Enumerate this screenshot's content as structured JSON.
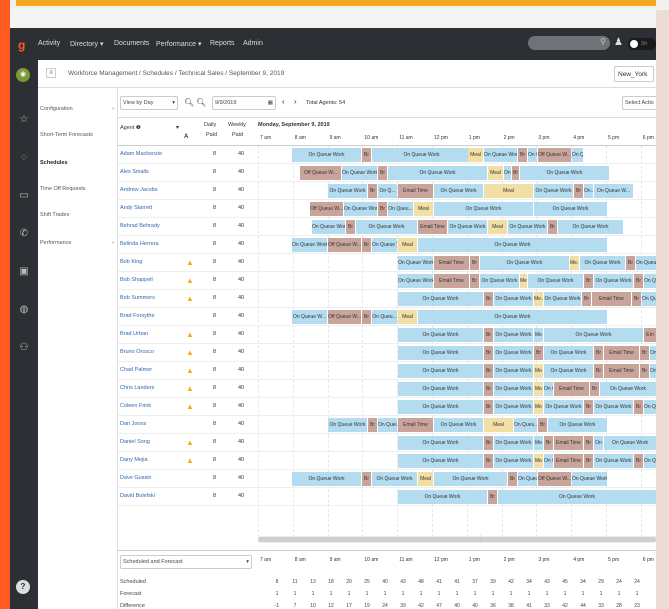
{
  "nav": {
    "items": [
      "Activity",
      "Directory ▾",
      "Documents",
      "Performance ▾",
      "Reports",
      "Admin"
    ]
  },
  "topbar": {
    "toggle_label": "Sh"
  },
  "breadcrumb": {
    "text": "Workforce Management / Schedules / Technical Sales / September 9, 2019"
  },
  "timezone": "New_York",
  "sidebar": {
    "items": [
      {
        "label": "Configuration",
        "chev": "›"
      },
      {
        "label": "Short-Term Forecasts",
        "chev": ""
      },
      {
        "label": "Schedules",
        "chev": ""
      },
      {
        "label": "Time Off Requests",
        "chev": ""
      },
      {
        "label": "Shift Trades",
        "chev": ""
      },
      {
        "label": "Performance",
        "chev": "›"
      }
    ]
  },
  "toolbar": {
    "view": "View by Day",
    "date": "9/9/2019",
    "total": "Total Agents: 54",
    "select_action": "Select Actio"
  },
  "header": {
    "agent": "Agent",
    "daily": "Daily",
    "paid1": "Paid",
    "weekly": "Weekly",
    "paid2": "Paid",
    "date": "Monday, September 9, 2019"
  },
  "hours": [
    "7 am",
    "8 am",
    "9 am",
    "10 am",
    "11 am",
    "12 pm",
    "1 pm",
    "2 pm",
    "3 pm",
    "4 pm",
    "5 pm",
    "6 pm"
  ],
  "agents": [
    {
      "name": "Adam Mackenzie",
      "warn": false,
      "daily": "8",
      "weekly": "40"
    },
    {
      "name": "Alex Smalls",
      "warn": false,
      "daily": "8",
      "weekly": "40"
    },
    {
      "name": "Andrew Jacobs",
      "warn": false,
      "daily": "8",
      "weekly": "40"
    },
    {
      "name": "Andy Starrett",
      "warn": false,
      "daily": "8",
      "weekly": "40"
    },
    {
      "name": "Behrad Behrady",
      "warn": false,
      "daily": "8",
      "weekly": "40"
    },
    {
      "name": "Belinda Herrera",
      "warn": false,
      "daily": "8",
      "weekly": "40"
    },
    {
      "name": "Bob King",
      "warn": true,
      "daily": "8",
      "weekly": "40"
    },
    {
      "name": "Bob Shappell",
      "warn": true,
      "daily": "8",
      "weekly": "40"
    },
    {
      "name": "Bob Summers",
      "warn": true,
      "daily": "8",
      "weekly": "40"
    },
    {
      "name": "Brad Forsythe",
      "warn": false,
      "daily": "8",
      "weekly": "40"
    },
    {
      "name": "Brad Urban",
      "warn": true,
      "daily": "8",
      "weekly": "40"
    },
    {
      "name": "Bruno Orozco",
      "warn": true,
      "daily": "8",
      "weekly": "40"
    },
    {
      "name": "Chad Palmer",
      "warn": true,
      "daily": "8",
      "weekly": "40"
    },
    {
      "name": "Chris Landers",
      "warn": true,
      "daily": "8",
      "weekly": "40"
    },
    {
      "name": "Coleen Frink",
      "warn": true,
      "daily": "8",
      "weekly": "40"
    },
    {
      "name": "Dan Joons",
      "warn": false,
      "daily": "8",
      "weekly": "40"
    },
    {
      "name": "Daniel Song",
      "warn": true,
      "daily": "8",
      "weekly": "40"
    },
    {
      "name": "Dany Mejia",
      "warn": true,
      "daily": "8",
      "weekly": "40"
    },
    {
      "name": "Dave Gussin",
      "warn": false,
      "daily": "8",
      "weekly": "40"
    },
    {
      "name": "David Bolefski",
      "warn": false,
      "daily": "8",
      "weekly": "40"
    }
  ],
  "rows_segments": [
    [
      [
        "q",
        34,
        70,
        "On Queue Work"
      ],
      [
        "o",
        104,
        10,
        "Br"
      ],
      [
        "q",
        114,
        100,
        "On Queue Work"
      ],
      [
        "m",
        210,
        16,
        "Meal"
      ],
      [
        "q",
        226,
        34,
        "On Queue Work"
      ],
      [
        "o",
        260,
        10,
        "Br"
      ],
      [
        "q",
        270,
        10,
        "On Q..."
      ],
      [
        "o",
        280,
        34,
        "Off Queue W..."
      ],
      [
        "q",
        314,
        12,
        "On Q..."
      ]
    ],
    [
      [
        "o",
        42,
        42,
        "Off Queue W..."
      ],
      [
        "q",
        84,
        36,
        "On Queue Work"
      ],
      [
        "o",
        120,
        10,
        "Br"
      ],
      [
        "q",
        130,
        100,
        "On Queue Work"
      ],
      [
        "m",
        230,
        16,
        "Meal"
      ],
      [
        "q",
        246,
        8,
        "On Q..."
      ],
      [
        "o",
        254,
        8,
        "Br"
      ],
      [
        "q",
        262,
        90,
        "On Queue Work"
      ]
    ],
    [
      [
        "q",
        70,
        40,
        "On Queue Work"
      ],
      [
        "o",
        110,
        10,
        "Br"
      ],
      [
        "q",
        120,
        20,
        "On Q..."
      ],
      [
        "t",
        140,
        36,
        "Email Time"
      ],
      [
        "q",
        176,
        50,
        "On Queue Work"
      ],
      [
        "m",
        226,
        50,
        "Meal"
      ],
      [
        "q",
        276,
        40,
        "On Queue Work"
      ],
      [
        "o",
        316,
        10,
        "Br"
      ],
      [
        "q",
        326,
        10,
        "On..."
      ],
      [
        "q",
        336,
        40,
        "On Queue W..."
      ]
    ],
    [
      [
        "o",
        52,
        34,
        "Off Queue W..."
      ],
      [
        "q",
        86,
        34,
        "On Queue Work"
      ],
      [
        "o",
        120,
        10,
        "Br"
      ],
      [
        "q",
        130,
        26,
        "On Queu..."
      ],
      [
        "m",
        156,
        20,
        "Meal"
      ],
      [
        "q",
        176,
        100,
        "On Queue Work"
      ],
      [
        "q",
        276,
        74,
        "On Queue Work"
      ]
    ],
    [
      [
        "q",
        54,
        34,
        "On Queue Work"
      ],
      [
        "o",
        88,
        10,
        "Br"
      ],
      [
        "q",
        98,
        62,
        "On Queue Work"
      ],
      [
        "t",
        160,
        30,
        "Email Time"
      ],
      [
        "q",
        190,
        40,
        "On Queue Work"
      ],
      [
        "m",
        230,
        20,
        "Meal"
      ],
      [
        "q",
        250,
        40,
        "On Queue Work"
      ],
      [
        "o",
        290,
        10,
        "Br"
      ],
      [
        "q",
        300,
        66,
        "On Queue Work"
      ]
    ],
    [
      [
        "q",
        34,
        36,
        "On Queue Work"
      ],
      [
        "o",
        70,
        34,
        "Off Queue W..."
      ],
      [
        "o",
        104,
        10,
        "Br"
      ],
      [
        "q",
        114,
        26,
        "On Queue W..."
      ],
      [
        "m",
        140,
        20,
        "Meal"
      ],
      [
        "q",
        160,
        190,
        "On Queue Work"
      ]
    ],
    [
      [
        "q",
        140,
        36,
        "On Queue Work"
      ],
      [
        "t",
        176,
        36,
        "Email Time"
      ],
      [
        "o",
        212,
        10,
        "Br"
      ],
      [
        "q",
        222,
        90,
        "On Queue Work"
      ],
      [
        "m",
        312,
        10,
        "Me..."
      ],
      [
        "q",
        322,
        46,
        "On Queue Work"
      ],
      [
        "o",
        368,
        10,
        "Br"
      ],
      [
        "q",
        378,
        30,
        "On Queue Work"
      ]
    ],
    [
      [
        "q",
        140,
        36,
        "On Queue Work"
      ],
      [
        "t",
        176,
        36,
        "Email Time"
      ],
      [
        "o",
        212,
        10,
        "Br"
      ],
      [
        "q",
        222,
        40,
        "On Queue Work"
      ],
      [
        "m",
        262,
        8,
        "Me..."
      ],
      [
        "q",
        270,
        56,
        "On Queue Work"
      ],
      [
        "o",
        326,
        10,
        "Br"
      ],
      [
        "q",
        336,
        40,
        "On Queue Work"
      ],
      [
        "o",
        376,
        10,
        "Br"
      ],
      [
        "q",
        386,
        22,
        "On Queue"
      ]
    ],
    [
      [
        "q",
        140,
        86,
        "On Queue Work"
      ],
      [
        "o",
        226,
        10,
        "Br"
      ],
      [
        "q",
        236,
        40,
        "On Queue Work"
      ],
      [
        "m",
        276,
        10,
        "Me..."
      ],
      [
        "q",
        286,
        38,
        "On Queue Work"
      ],
      [
        "o",
        324,
        10,
        "Br"
      ],
      [
        "t",
        334,
        40,
        "Email Time"
      ],
      [
        "o",
        374,
        10,
        "Br"
      ],
      [
        "q",
        384,
        24,
        "On Queue Wo"
      ]
    ],
    [
      [
        "q",
        34,
        36,
        "On Queue W..."
      ],
      [
        "o",
        70,
        34,
        "Off Queue W..."
      ],
      [
        "o",
        104,
        10,
        "Br"
      ],
      [
        "q",
        114,
        26,
        "On Queu..."
      ],
      [
        "m",
        140,
        20,
        "Meal"
      ],
      [
        "q",
        160,
        190,
        "On Queue Work"
      ]
    ],
    [
      [
        "q",
        140,
        86,
        "On Queue Work"
      ],
      [
        "o",
        226,
        10,
        "Br"
      ],
      [
        "q",
        236,
        40,
        "On Queue Work"
      ],
      [
        "q",
        276,
        10,
        "Me"
      ],
      [
        "q",
        286,
        100,
        "On Queue Work"
      ],
      [
        "o",
        386,
        22,
        "Em"
      ]
    ],
    [
      [
        "q",
        140,
        86,
        "On Queue Work"
      ],
      [
        "o",
        226,
        10,
        "Br"
      ],
      [
        "q",
        236,
        40,
        "On Queue Work"
      ],
      [
        "o",
        276,
        10,
        "Br"
      ],
      [
        "q",
        286,
        50,
        "On Queue Work"
      ],
      [
        "o",
        336,
        10,
        "Br"
      ],
      [
        "t",
        346,
        36,
        "Email Time"
      ],
      [
        "o",
        382,
        10,
        "Br"
      ],
      [
        "q",
        392,
        16,
        "On Q"
      ]
    ],
    [
      [
        "q",
        140,
        86,
        "On Queue Work"
      ],
      [
        "o",
        226,
        10,
        "Br"
      ],
      [
        "q",
        236,
        40,
        "On Queue Work"
      ],
      [
        "m",
        276,
        10,
        "Me"
      ],
      [
        "q",
        286,
        50,
        "On Queue Work"
      ],
      [
        "o",
        336,
        10,
        "Br"
      ],
      [
        "t",
        346,
        36,
        "Email Time"
      ],
      [
        "o",
        382,
        10,
        "Br"
      ],
      [
        "q",
        392,
        16,
        "On Q"
      ]
    ],
    [
      [
        "q",
        140,
        86,
        "On Queue Work"
      ],
      [
        "o",
        226,
        10,
        "Br"
      ],
      [
        "q",
        236,
        40,
        "On Queue Work"
      ],
      [
        "m",
        276,
        10,
        "Me"
      ],
      [
        "q",
        286,
        10,
        "On Q"
      ],
      [
        "t",
        296,
        36,
        "Email Time"
      ],
      [
        "o",
        332,
        10,
        "Br"
      ],
      [
        "q",
        342,
        66,
        "On Queue Work"
      ]
    ],
    [
      [
        "q",
        140,
        86,
        "On Queue Work"
      ],
      [
        "o",
        226,
        10,
        "Br"
      ],
      [
        "q",
        236,
        40,
        "On Queue Work"
      ],
      [
        "m",
        276,
        10,
        "Me"
      ],
      [
        "q",
        286,
        40,
        "On Queue Work"
      ],
      [
        "o",
        326,
        10,
        "Br"
      ],
      [
        "q",
        336,
        40,
        "On Queue Work"
      ],
      [
        "o",
        376,
        10,
        "Br"
      ],
      [
        "q",
        386,
        22,
        "On Queue"
      ]
    ],
    [
      [
        "q",
        70,
        40,
        "On Queue Work"
      ],
      [
        "o",
        110,
        10,
        "Br"
      ],
      [
        "q",
        120,
        20,
        "On Queu..."
      ],
      [
        "t",
        140,
        36,
        "Email Time"
      ],
      [
        "q",
        176,
        50,
        "On Queue Work"
      ],
      [
        "m",
        226,
        30,
        "Meal"
      ],
      [
        "q",
        256,
        24,
        "On Queu..."
      ],
      [
        "o",
        280,
        10,
        "Br"
      ],
      [
        "q",
        290,
        60,
        "On Queue Work"
      ]
    ],
    [
      [
        "q",
        140,
        86,
        "On Queue Work"
      ],
      [
        "o",
        226,
        10,
        "Br"
      ],
      [
        "q",
        236,
        40,
        "On Queue Work"
      ],
      [
        "q",
        276,
        10,
        "Me"
      ],
      [
        "o",
        286,
        10,
        "Br"
      ],
      [
        "t",
        296,
        30,
        "Email Time"
      ],
      [
        "o",
        326,
        10,
        "Br"
      ],
      [
        "q",
        336,
        10,
        "On"
      ],
      [
        "q",
        346,
        62,
        "On Queue Work"
      ]
    ],
    [
      [
        "q",
        140,
        86,
        "On Queue Work"
      ],
      [
        "o",
        226,
        10,
        "Br"
      ],
      [
        "q",
        236,
        40,
        "On Queue Work"
      ],
      [
        "m",
        276,
        10,
        "Me"
      ],
      [
        "q",
        286,
        10,
        "On Q"
      ],
      [
        "t",
        296,
        30,
        "Email Time"
      ],
      [
        "o",
        326,
        10,
        "Br"
      ],
      [
        "q",
        336,
        40,
        "On Queue Work"
      ],
      [
        "o",
        376,
        10,
        "Br"
      ],
      [
        "q",
        386,
        22,
        "On Queue"
      ]
    ],
    [
      [
        "q",
        34,
        70,
        "On Queue Work"
      ],
      [
        "o",
        104,
        10,
        "Br"
      ],
      [
        "q",
        114,
        46,
        "On Queue Work"
      ],
      [
        "m",
        160,
        16,
        "Meal"
      ],
      [
        "q",
        176,
        74,
        "On Queue Work"
      ],
      [
        "o",
        250,
        10,
        "Br"
      ],
      [
        "q",
        260,
        20,
        "On Queu..."
      ],
      [
        "o",
        280,
        34,
        "Off Queue W..."
      ],
      [
        "q",
        314,
        36,
        "On Queue Work"
      ]
    ],
    [
      [
        "q",
        140,
        90,
        "On Queue Work"
      ],
      [
        "o",
        230,
        10,
        "Br"
      ],
      [
        "q",
        240,
        168,
        "On Queue Work"
      ]
    ]
  ],
  "forecast": {
    "selector": "Scheduled and Forecast",
    "labels": [
      "Scheduled",
      "Forecast",
      "Difference"
    ],
    "scheduled": [
      "8",
      "11",
      "13",
      "18",
      "20",
      "25",
      "40",
      "43",
      "48",
      "41",
      "41",
      "37",
      "39",
      "42",
      "34",
      "43",
      "45",
      "34",
      "29",
      "24",
      "24"
    ],
    "forecast": [
      "1",
      "1",
      "1",
      "1",
      "1",
      "1",
      "1",
      "1",
      "1",
      "1",
      "1",
      "1",
      "1",
      "1",
      "1",
      "1",
      "1",
      "1",
      "1",
      "1",
      "1"
    ],
    "difference": [
      "-1",
      "7",
      "10",
      "12",
      "17",
      "19",
      "24",
      "39",
      "42",
      "47",
      "40",
      "40",
      "36",
      "38",
      "41",
      "33",
      "42",
      "44",
      "33",
      "28",
      "23"
    ]
  }
}
